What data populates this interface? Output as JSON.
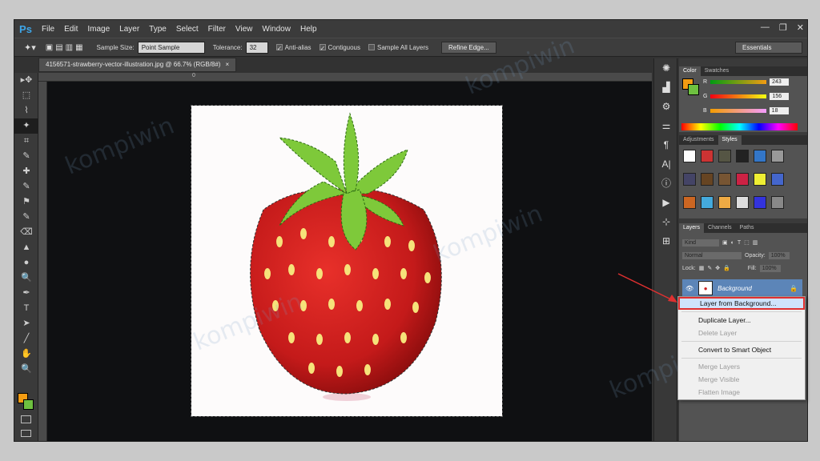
{
  "app": {
    "logo": "Ps"
  },
  "menu": [
    "File",
    "Edit",
    "Image",
    "Layer",
    "Type",
    "Select",
    "Filter",
    "View",
    "Window",
    "Help"
  ],
  "window_controls": {
    "minimize": "—",
    "restore": "❐",
    "close": "✕"
  },
  "options": {
    "sample_size_label": "Sample Size:",
    "sample_size_value": "Point Sample",
    "tolerance_label": "Tolerance:",
    "tolerance_value": "32",
    "anti_alias": "Anti-alias",
    "contiguous": "Contiguous",
    "sample_all": "Sample All Layers",
    "refine_edge": "Refine Edge...",
    "workspace": "Essentials"
  },
  "document": {
    "tab": "4156571-strawberry-vector-illustration.jpg @ 66.7% (RGB/8#)",
    "close": "×",
    "ruler_zero": "0"
  },
  "tools": [
    "▸✥",
    "⬚",
    "⌇",
    "✦",
    "⌗",
    "✎",
    "✚",
    "✎",
    "⚑",
    "✎",
    "⌫",
    "▲",
    "●",
    "🔍",
    "✒",
    "T",
    "➤",
    "╱",
    "✋",
    "🔍"
  ],
  "dock_icons": [
    "✺",
    "▟",
    "⚙",
    "⚌",
    "¶",
    "A|",
    "ⓘ",
    "▶",
    "⊹",
    "⊞"
  ],
  "color_panel": {
    "tabs": [
      "Color",
      "Swatches"
    ],
    "r_label": "R",
    "r_value": "243",
    "g_label": "G",
    "g_value": "156",
    "b_label": "B",
    "b_value": "18",
    "fg_color": "#f39c12",
    "bg_color": "#6ec040"
  },
  "adjustments": {
    "tabs": [
      "Adjustments",
      "Styles"
    ]
  },
  "layers_panel": {
    "tabs": [
      "Layers",
      "Channels",
      "Paths"
    ],
    "kind": "Kind",
    "blend": "Normal",
    "opacity_label": "Opacity:",
    "opacity_value": "100%",
    "lock_label": "Lock:",
    "fill_label": "Fill:",
    "fill_value": "100%",
    "background_layer": "Background"
  },
  "context_menu": {
    "layer_from_background": "Layer from Background...",
    "duplicate_layer": "Duplicate Layer...",
    "delete_layer": "Delete Layer",
    "convert_smart": "Convert to Smart Object",
    "merge_layers": "Merge Layers",
    "merge_visible": "Merge Visible",
    "flatten_image": "Flatten Image"
  },
  "watermark": "kompiwin",
  "colors": {
    "accent": "#3ea6e8",
    "highlight_border": "#e03030",
    "arrow": "#e03030"
  }
}
